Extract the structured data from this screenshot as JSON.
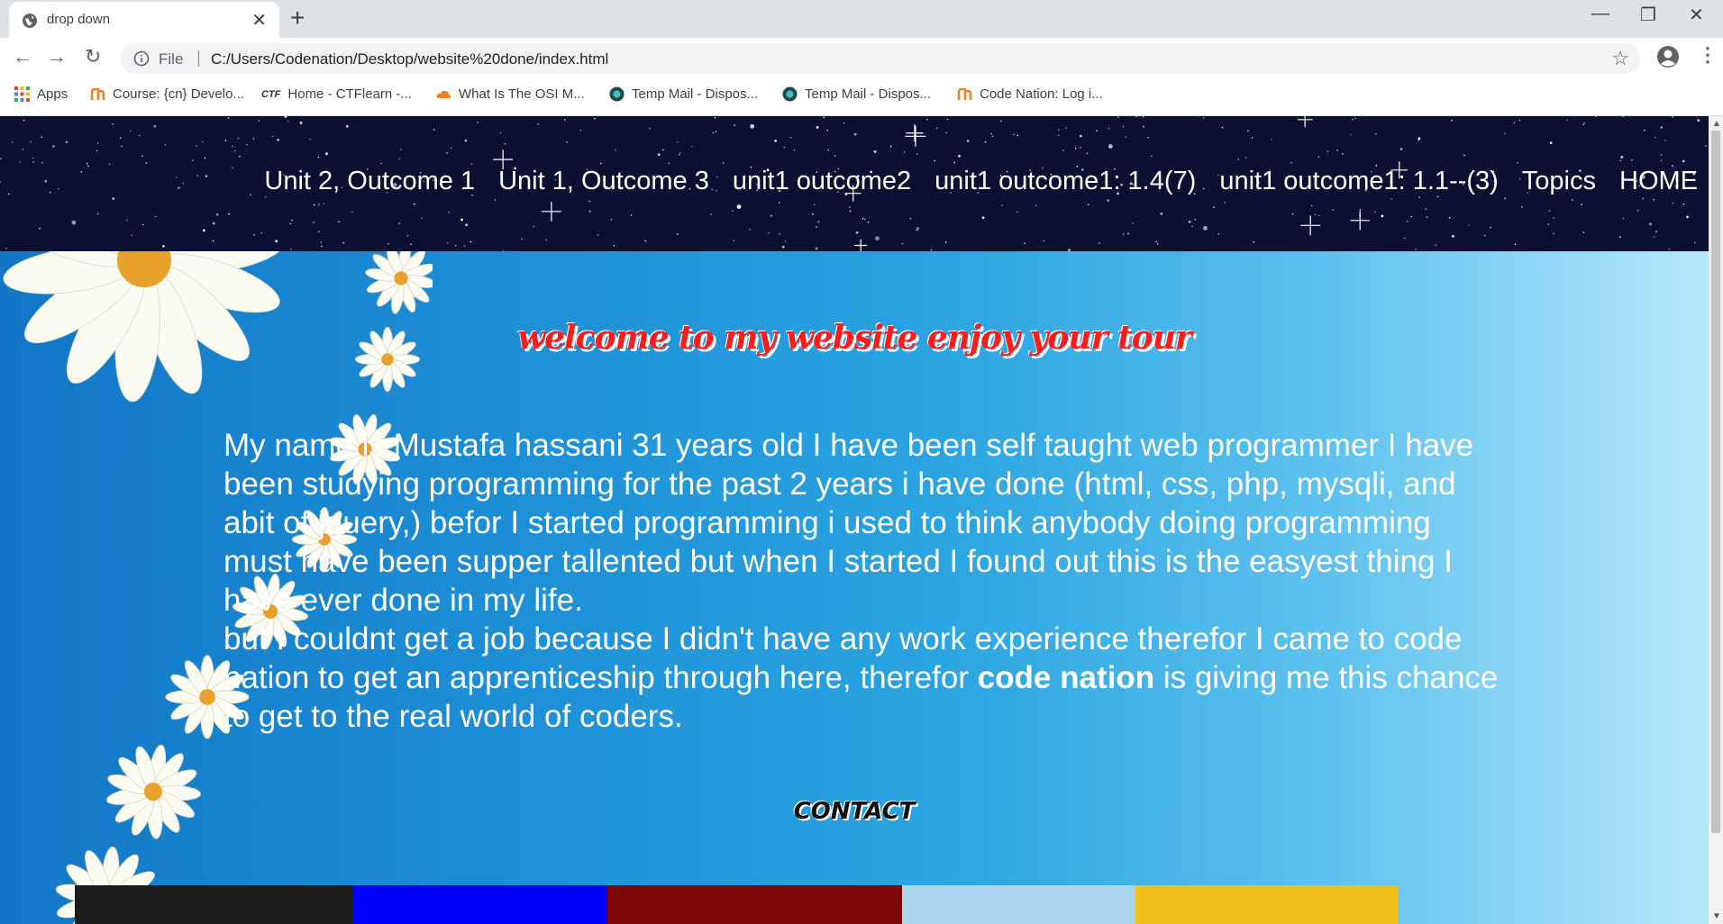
{
  "browser": {
    "tab": {
      "title": "drop down",
      "close_glyph": "✕"
    },
    "new_tab_glyph": "+",
    "window_controls": {
      "minimize": "—",
      "restore": "❐",
      "close": "✕"
    },
    "address": {
      "scheme_label": "File",
      "separator": "|",
      "url": "C:/Users/Codenation/Desktop/website%20done/index.html"
    },
    "nav_glyphs": {
      "back": "←",
      "forward": "→",
      "reload": "↻",
      "star": "☆",
      "menu": "⋮"
    },
    "bookmarks": [
      {
        "label": "Apps",
        "icon": "apps-grid-icon"
      },
      {
        "label": "Course: {cn} Develo...",
        "icon": "codenation-icon"
      },
      {
        "label": "Home - CTFlearn -...",
        "icon": "ctf-icon",
        "icon_text": "CTF"
      },
      {
        "label": "What Is The OSI M...",
        "icon": "cloud-icon"
      },
      {
        "label": "Temp Mail - Dispos...",
        "icon": "tempmail-icon"
      },
      {
        "label": "Temp Mail - Dispos...",
        "icon": "tempmail-icon"
      },
      {
        "label": "Code Nation: Log i...",
        "icon": "codenation-icon"
      }
    ]
  },
  "page": {
    "nav": [
      "Unit 2, Outcome 1",
      "Unit 1, Outcome 3",
      "unit1 outcome2",
      "unit1 outcome1: 1.4(7)",
      "unit1 outcome1: 1.1--(3)",
      "Topics",
      "HOME"
    ],
    "welcome": "welcome to my website enjoy your tour",
    "bio": {
      "part1": "My name is Mustafa hassani 31 years old I have been self taught web programmer I have been studying programming for the past 2 years i have done (html, css, php, mysqli, and abit of jquery,) befor I started programming i used to think anybody doing programming must have been supper tallented but when I started I found out this is the easyest thing I have ever done in my life.",
      "part2": "but I couldnt get a job because I didn't have any work experience therefor I came to code nation to get an apprenticeship through here, therefor ",
      "bold": "code nation",
      "part3": " is giving me this chance to get to the real world of coders."
    },
    "contact": "CONTACT",
    "color_strip": [
      {
        "color": "#1c1c1c",
        "width_pct": 17.8
      },
      {
        "color": "#0000ff",
        "width_pct": 16.4
      },
      {
        "color": "#7d0606",
        "width_pct": 18.9
      },
      {
        "color": "#acd5ee",
        "width_pct": 15.0
      },
      {
        "color": "#f0c11a",
        "width_pct": 16.9
      }
    ]
  },
  "colors": {
    "header_bg": "#0b1133",
    "welcome_text": "#ff1b1b",
    "gradient_start": "#1277c6",
    "gradient_end": "#b7e8fb"
  }
}
